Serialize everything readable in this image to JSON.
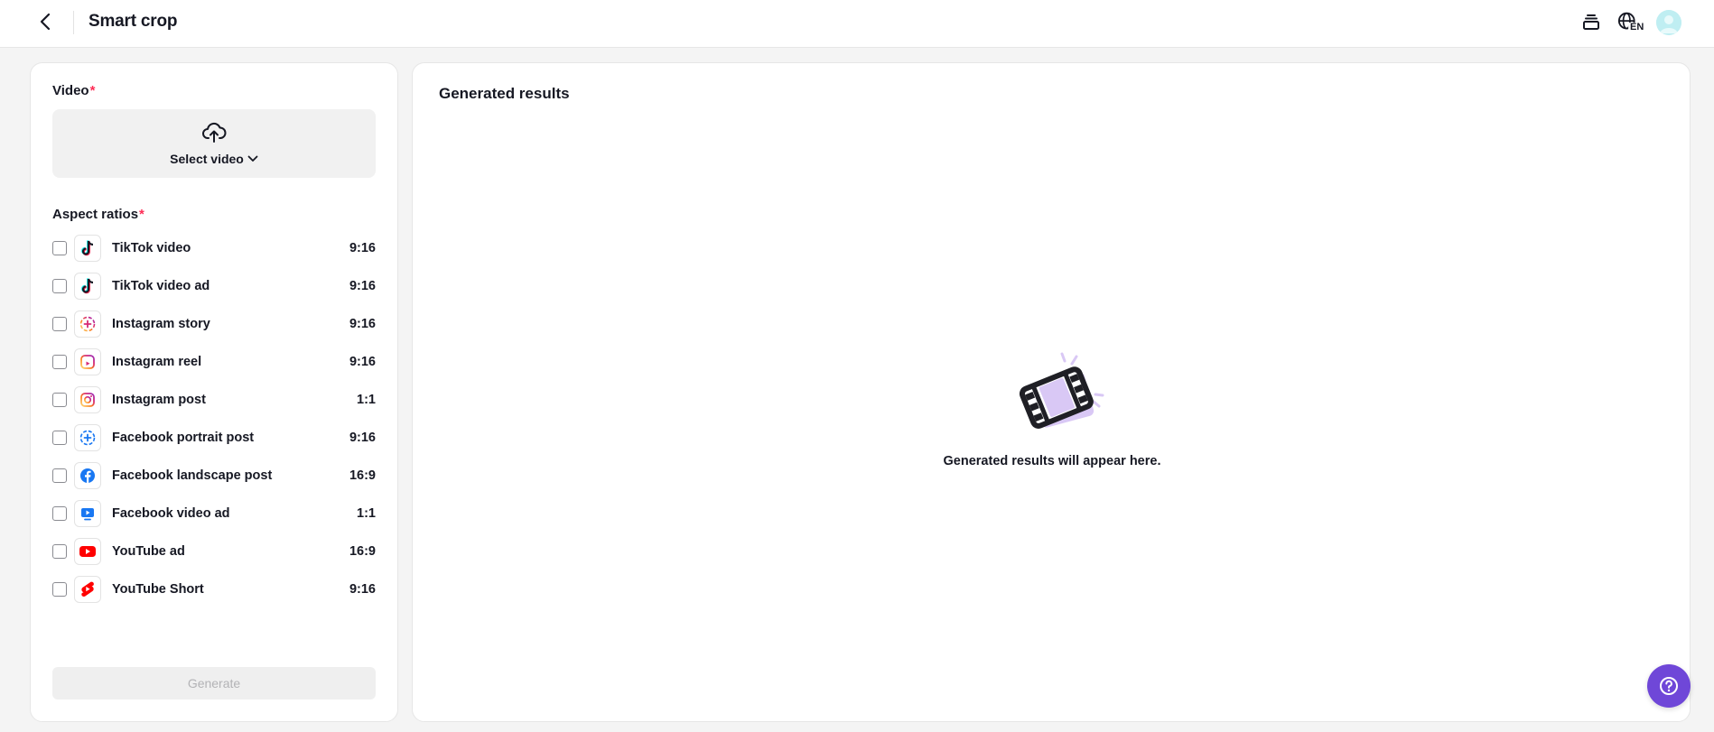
{
  "header": {
    "title": "Smart crop",
    "back_icon": "chevron-left-icon",
    "right_icons": [
      "stack-icon",
      "language-icon",
      "avatar"
    ],
    "language_code": "EN"
  },
  "left_panel": {
    "video_label": "Video",
    "required_mark": "*",
    "upload": {
      "icon": "cloud-upload-icon",
      "label": "Select video"
    },
    "aspect_label": "Aspect ratios",
    "ratios": [
      {
        "name": "TikTok video",
        "ratio": "9:16",
        "icon": "tiktok-icon",
        "checked": false
      },
      {
        "name": "TikTok video ad",
        "ratio": "9:16",
        "icon": "tiktok-icon",
        "checked": false
      },
      {
        "name": "Instagram story",
        "ratio": "9:16",
        "icon": "instagram-story-icon",
        "checked": false
      },
      {
        "name": "Instagram reel",
        "ratio": "9:16",
        "icon": "instagram-reel-icon",
        "checked": false
      },
      {
        "name": "Instagram post",
        "ratio": "1:1",
        "icon": "instagram-icon",
        "checked": false
      },
      {
        "name": "Facebook portrait post",
        "ratio": "9:16",
        "icon": "facebook-story-icon",
        "checked": false
      },
      {
        "name": "Facebook landscape post",
        "ratio": "16:9",
        "icon": "facebook-icon",
        "checked": false
      },
      {
        "name": "Facebook video ad",
        "ratio": "1:1",
        "icon": "facebook-video-icon",
        "checked": false
      },
      {
        "name": "YouTube ad",
        "ratio": "16:9",
        "icon": "youtube-icon",
        "checked": false
      },
      {
        "name": "YouTube Short",
        "ratio": "9:16",
        "icon": "youtube-shorts-icon",
        "checked": false
      }
    ],
    "generate_label": "Generate"
  },
  "right_panel": {
    "title": "Generated results",
    "empty_icon": "film-icon",
    "empty_text": "Generated results will appear here."
  },
  "help_icon": "help-icon",
  "colors": {
    "accent_purple": "#6f47d8",
    "required_red": "#fe2c55",
    "illustration_lavender": "#d9c8f5"
  }
}
